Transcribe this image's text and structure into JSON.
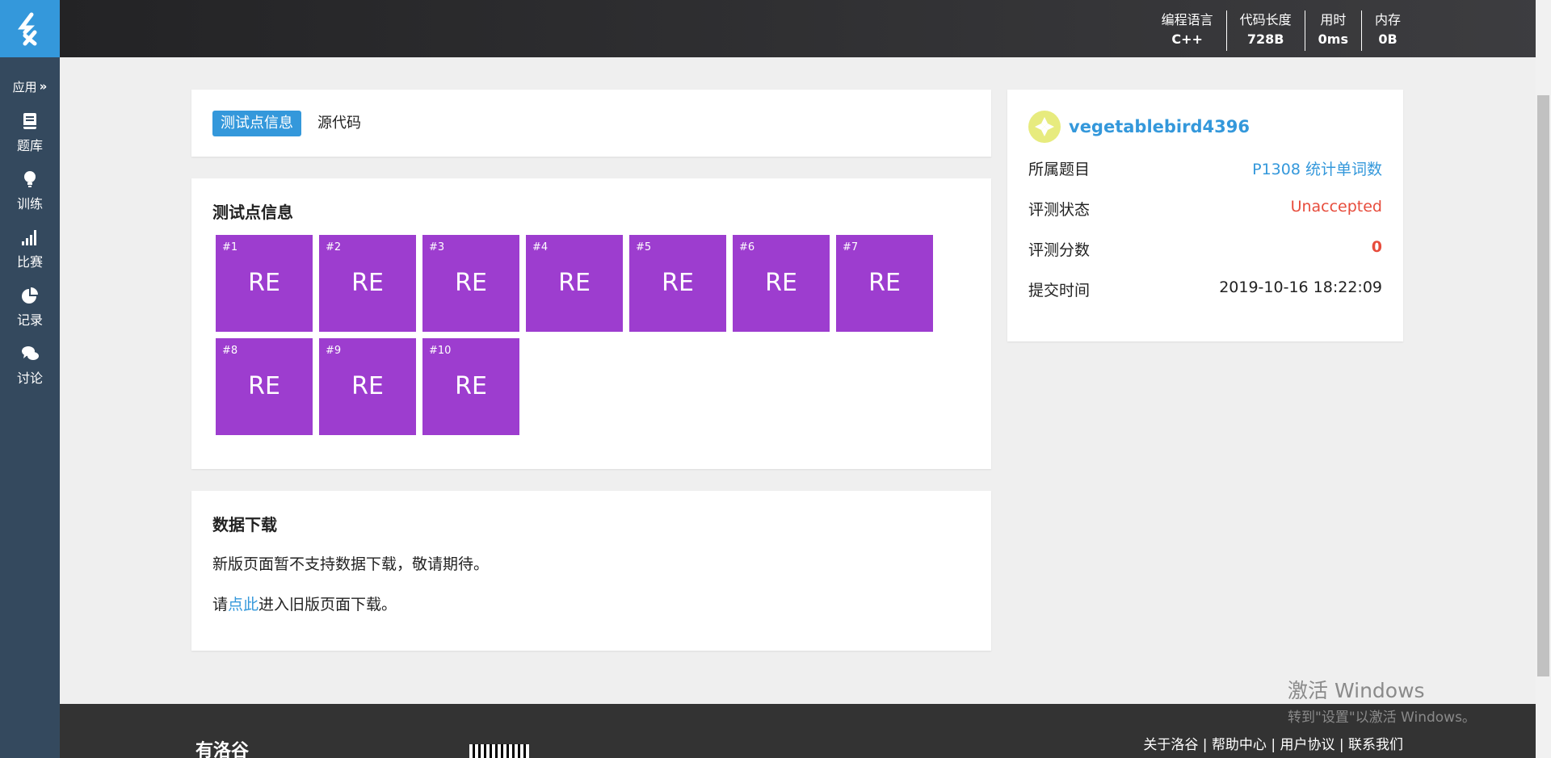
{
  "sidebar": {
    "apps_label": "应用",
    "items": [
      {
        "label": "题库",
        "icon": "book-icon"
      },
      {
        "label": "训练",
        "icon": "lightbulb-icon"
      },
      {
        "label": "比赛",
        "icon": "signal-bars-icon"
      },
      {
        "label": "记录",
        "icon": "pie-chart-icon"
      },
      {
        "label": "讨论",
        "icon": "chat-bubbles-icon"
      }
    ]
  },
  "topbar": {
    "stats": [
      {
        "label": "编程语言",
        "value": "C++"
      },
      {
        "label": "代码长度",
        "value": "728B"
      },
      {
        "label": "用时",
        "value": "0ms"
      },
      {
        "label": "内存",
        "value": "0B"
      }
    ]
  },
  "tabs": [
    {
      "label": "测试点信息",
      "active": true
    },
    {
      "label": "源代码",
      "active": false
    }
  ],
  "tests": {
    "title": "测试点信息",
    "cases": [
      {
        "id": "#1",
        "status": "RE"
      },
      {
        "id": "#2",
        "status": "RE"
      },
      {
        "id": "#3",
        "status": "RE"
      },
      {
        "id": "#4",
        "status": "RE"
      },
      {
        "id": "#5",
        "status": "RE"
      },
      {
        "id": "#6",
        "status": "RE"
      },
      {
        "id": "#7",
        "status": "RE"
      },
      {
        "id": "#8",
        "status": "RE"
      },
      {
        "id": "#9",
        "status": "RE"
      },
      {
        "id": "#10",
        "status": "RE"
      }
    ],
    "status_color": "#9d3dcf"
  },
  "download": {
    "title": "数据下载",
    "line1": "新版页面暂不支持数据下载，敬请期待。",
    "line2_prefix": "请",
    "line2_link": "点此",
    "line2_suffix": "进入旧版页面下载。"
  },
  "info": {
    "username": "vegetablebird4396",
    "rows": [
      {
        "key": "所属题目",
        "value": "P1308 统计单词数"
      },
      {
        "key": "评测状态",
        "value": "Unaccepted"
      },
      {
        "key": "评测分数",
        "value": "0"
      },
      {
        "key": "提交时间",
        "value": "2019-10-16 18:22:09"
      }
    ]
  },
  "footer": {
    "links": "关于洛谷 | 帮助中心 | 用户协议 | 联系我们",
    "logo_text": "有洛谷"
  },
  "watermark": {
    "line1": "激活 Windows",
    "line2": "转到\"设置\"以激活 Windows。"
  },
  "colors": {
    "accent": "#3498db",
    "sidebar": "#34495e",
    "error": "#e74c3c"
  }
}
